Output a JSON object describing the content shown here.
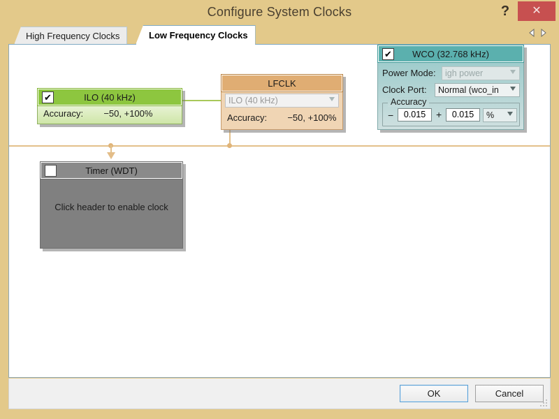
{
  "window": {
    "title": "Configure System Clocks",
    "help_label": "?",
    "close_label": "✕"
  },
  "tabs": [
    {
      "label": "High Frequency Clocks",
      "active": false
    },
    {
      "label": "Low Frequency Clocks",
      "active": true
    }
  ],
  "tab_nav": {
    "prev_icon": "triangle-left-icon",
    "next_icon": "triangle-right-icon"
  },
  "nodes": {
    "ilo": {
      "title": "ILO (40 kHz)",
      "enabled": true,
      "checkbox_glyph": "✔",
      "accuracy_label": "Accuracy:",
      "accuracy_value": "−50, +100%",
      "color": "#8dc63f"
    },
    "lfclk": {
      "title": "LFCLK",
      "source_value": "ILO (40 kHz)",
      "accuracy_label": "Accuracy:",
      "accuracy_value": "−50, +100%",
      "color": "#e0ad73"
    },
    "wco": {
      "title": "WCO (32.768 kHz)",
      "enabled": true,
      "checkbox_glyph": "✔",
      "power_mode_label": "Power Mode:",
      "power_mode_value": "igh power",
      "clock_port_label": "Clock Port:",
      "clock_port_value": "Normal (wco_in",
      "accuracy_group_label": "Accuracy",
      "minus_sign": "−",
      "accuracy_minus_value": "0.015",
      "plus_sign": "+",
      "accuracy_plus_value": "0.015",
      "accuracy_units_value": "%",
      "color": "#5bb0ae"
    },
    "timer": {
      "title": "Timer (WDT)",
      "enabled": false,
      "checkbox_glyph": "",
      "message": "Click header to enable clock",
      "color": "#808080"
    }
  },
  "footer": {
    "ok_label": "OK",
    "cancel_label": "Cancel"
  }
}
